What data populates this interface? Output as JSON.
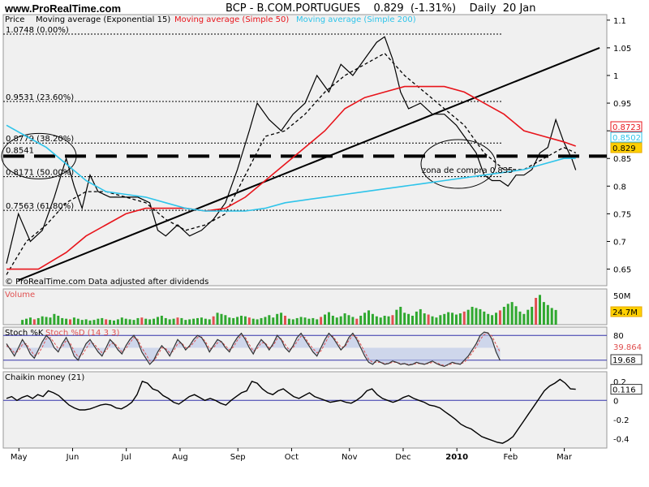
{
  "header": {
    "site": "www.ProRealTime.com",
    "title": "BCP - B.COM.PORTUGUES    0.829  (-1.31%)    Daily  20 Jan"
  },
  "colors": {
    "price": "#000000",
    "ema15": "#000000",
    "sma50": "#e8141b",
    "sma200": "#2ec4ea",
    "volume": "#2fa82f",
    "volume_down": "#e05050",
    "stoch_k": "#333333",
    "stoch_d": "#e05050",
    "stoch_fill": "#b8c4e8",
    "panel_bg": "#f0f0f0",
    "ref_line": "#3333aa"
  },
  "chart_data": [
    {
      "type": "line",
      "panel": "price",
      "legend": {
        "price": "Price",
        "ema15": "Moving average (Exponential 15)",
        "sma50": "Moving average (Simple 50)",
        "sma200": "Moving average (Simple 200)"
      },
      "x_labels": [
        "May",
        "Jun",
        "Jul",
        "Aug",
        "Sep",
        "Oct",
        "Nov",
        "Dec",
        "2010",
        "Feb",
        "Mar"
      ],
      "y_ticks": [
        0.65,
        0.7,
        0.75,
        0.8,
        0.85,
        0.9,
        0.95,
        1,
        1.05,
        1.1
      ],
      "ylim": [
        0.62,
        1.11
      ],
      "series": [
        {
          "name": "Price",
          "points": [
            [
              0,
              0.66
            ],
            [
              3,
              0.75
            ],
            [
              6,
              0.7
            ],
            [
              9,
              0.72
            ],
            [
              12,
              0.78
            ],
            [
              15,
              0.85
            ],
            [
              17,
              0.8
            ],
            [
              19,
              0.76
            ],
            [
              21,
              0.82
            ],
            [
              23,
              0.79
            ],
            [
              26,
              0.78
            ],
            [
              30,
              0.78
            ],
            [
              33,
              0.78
            ],
            [
              36,
              0.77
            ],
            [
              38,
              0.72
            ],
            [
              40,
              0.71
            ],
            [
              43,
              0.73
            ],
            [
              46,
              0.71
            ],
            [
              49,
              0.72
            ],
            [
              52,
              0.74
            ],
            [
              55,
              0.77
            ],
            [
              58,
              0.83
            ],
            [
              61,
              0.9
            ],
            [
              63,
              0.95
            ],
            [
              66,
              0.92
            ],
            [
              69,
              0.9
            ],
            [
              72,
              0.93
            ],
            [
              75,
              0.95
            ],
            [
              78,
              1.0
            ],
            [
              81,
              0.97
            ],
            [
              84,
              1.02
            ],
            [
              87,
              1.0
            ],
            [
              90,
              1.03
            ],
            [
              93,
              1.06
            ],
            [
              95,
              1.07
            ],
            [
              97,
              1.03
            ],
            [
              99,
              0.97
            ],
            [
              101,
              0.94
            ],
            [
              104,
              0.95
            ],
            [
              107,
              0.93
            ],
            [
              110,
              0.93
            ],
            [
              113,
              0.91
            ],
            [
              115,
              0.89
            ],
            [
              118,
              0.86
            ],
            [
              120,
              0.82
            ],
            [
              122,
              0.81
            ],
            [
              124,
              0.81
            ],
            [
              126,
              0.8
            ],
            [
              128,
              0.82
            ],
            [
              130,
              0.82
            ],
            [
              132,
              0.83
            ],
            [
              134,
              0.86
            ],
            [
              136,
              0.87
            ],
            [
              138,
              0.92
            ],
            [
              140,
              0.88
            ],
            [
              142,
              0.85
            ],
            [
              143,
              0.829
            ]
          ]
        },
        {
          "name": "Moving average (Exponential 15)",
          "points": [
            [
              0,
              0.64
            ],
            [
              5,
              0.7
            ],
            [
              10,
              0.73
            ],
            [
              15,
              0.77
            ],
            [
              20,
              0.79
            ],
            [
              25,
              0.79
            ],
            [
              30,
              0.78
            ],
            [
              35,
              0.77
            ],
            [
              40,
              0.74
            ],
            [
              45,
              0.72
            ],
            [
              50,
              0.73
            ],
            [
              55,
              0.75
            ],
            [
              60,
              0.82
            ],
            [
              65,
              0.89
            ],
            [
              70,
              0.9
            ],
            [
              75,
              0.93
            ],
            [
              80,
              0.97
            ],
            [
              85,
              1.0
            ],
            [
              90,
              1.02
            ],
            [
              95,
              1.04
            ],
            [
              100,
              1.0
            ],
            [
              105,
              0.97
            ],
            [
              110,
              0.94
            ],
            [
              115,
              0.91
            ],
            [
              120,
              0.86
            ],
            [
              125,
              0.83
            ],
            [
              130,
              0.83
            ],
            [
              135,
              0.85
            ],
            [
              140,
              0.87
            ],
            [
              143,
              0.86
            ]
          ]
        },
        {
          "name": "Moving average (Simple 50)",
          "points": [
            [
              0,
              0.65
            ],
            [
              8,
              0.65
            ],
            [
              15,
              0.68
            ],
            [
              20,
              0.71
            ],
            [
              25,
              0.73
            ],
            [
              30,
              0.75
            ],
            [
              35,
              0.76
            ],
            [
              40,
              0.76
            ],
            [
              45,
              0.76
            ],
            [
              50,
              0.755
            ],
            [
              55,
              0.76
            ],
            [
              60,
              0.78
            ],
            [
              65,
              0.81
            ],
            [
              70,
              0.84
            ],
            [
              75,
              0.87
            ],
            [
              80,
              0.9
            ],
            [
              85,
              0.94
            ],
            [
              90,
              0.96
            ],
            [
              95,
              0.97
            ],
            [
              100,
              0.98
            ],
            [
              105,
              0.98
            ],
            [
              110,
              0.98
            ],
            [
              115,
              0.97
            ],
            [
              120,
              0.95
            ],
            [
              125,
              0.93
            ],
            [
              130,
              0.9
            ],
            [
              135,
              0.89
            ],
            [
              140,
              0.88
            ],
            [
              143,
              0.8723
            ]
          ]
        },
        {
          "name": "Moving average (Simple 200)",
          "points": [
            [
              0,
              0.91
            ],
            [
              5,
              0.89
            ],
            [
              10,
              0.87
            ],
            [
              15,
              0.84
            ],
            [
              20,
              0.81
            ],
            [
              25,
              0.79
            ],
            [
              30,
              0.785
            ],
            [
              35,
              0.78
            ],
            [
              40,
              0.77
            ],
            [
              45,
              0.76
            ],
            [
              50,
              0.755
            ],
            [
              55,
              0.755
            ],
            [
              60,
              0.755
            ],
            [
              65,
              0.76
            ],
            [
              70,
              0.77
            ],
            [
              75,
              0.775
            ],
            [
              80,
              0.78
            ],
            [
              85,
              0.785
            ],
            [
              90,
              0.79
            ],
            [
              95,
              0.795
            ],
            [
              100,
              0.8
            ],
            [
              105,
              0.805
            ],
            [
              110,
              0.81
            ],
            [
              115,
              0.815
            ],
            [
              120,
              0.82
            ],
            [
              125,
              0.825
            ],
            [
              130,
              0.83
            ],
            [
              135,
              0.84
            ],
            [
              140,
              0.85
            ],
            [
              143,
              0.8502
            ]
          ]
        }
      ],
      "fib_levels": [
        {
          "label": "1.0748 (0.00%)",
          "value": 1.0748
        },
        {
          "label": "0.9531 (23.60%)",
          "value": 0.9531
        },
        {
          "label": "0.8779 (38.20%)",
          "value": 0.8779
        },
        {
          "label": "0.8171 (50.00%)",
          "value": 0.8171
        },
        {
          "label": "0.7563 (61.80%)",
          "value": 0.7563
        }
      ],
      "support_level": {
        "label": "0.8541",
        "value": 0.8541
      },
      "trendline": [
        [
          3,
          0.63
        ],
        [
          149,
          1.05
        ]
      ],
      "annotations": [
        "zona de compra 0.835",
        "© ProRealTime.com  Data adjusted after dividends"
      ],
      "last_values": [
        {
          "value": "0.8723",
          "series": "sma50"
        },
        {
          "value": "0.8502",
          "series": "sma200"
        },
        {
          "value": "0.829",
          "series": "price"
        }
      ]
    },
    {
      "type": "bar",
      "panel": "volume",
      "legend": "Volume",
      "y_tick": "50M",
      "last_value": "24.7M",
      "ylim": [
        0,
        60
      ],
      "values": [
        8,
        10,
        12,
        9,
        11,
        14,
        13,
        12,
        18,
        15,
        11,
        10,
        9,
        12,
        10,
        8,
        9,
        7,
        8,
        10,
        11,
        9,
        8,
        7,
        9,
        12,
        10,
        9,
        8,
        11,
        12,
        10,
        9,
        10,
        13,
        15,
        11,
        9,
        10,
        12,
        11,
        8,
        9,
        10,
        11,
        12,
        10,
        9,
        14,
        20,
        18,
        16,
        12,
        11,
        13,
        15,
        14,
        12,
        10,
        9,
        11,
        13,
        16,
        12,
        18,
        20,
        15,
        10,
        9,
        11,
        13,
        12,
        10,
        11,
        9,
        13,
        17,
        21,
        15,
        12,
        14,
        19,
        16,
        13,
        10,
        15,
        20,
        24,
        18,
        14,
        12,
        15,
        14,
        16,
        25,
        30,
        20,
        18,
        15,
        22,
        26,
        19,
        17,
        14,
        12,
        16,
        18,
        21,
        20,
        17,
        19,
        22,
        25,
        30,
        28,
        26,
        22,
        18,
        16,
        20,
        24,
        30,
        35,
        38,
        31,
        22,
        18,
        25,
        30,
        45,
        50,
        38,
        33,
        28,
        24.7
      ]
    },
    {
      "type": "line",
      "panel": "stochastic",
      "legend_k": "Stoch %K",
      "legend_d": "Stoch %D (14 3 3)",
      "ylim": [
        0,
        100
      ],
      "levels": [
        80,
        20
      ],
      "level_labels": [
        "80",
        "20"
      ],
      "last_values": {
        "d": "39.864",
        "k": "19.68"
      },
      "k": [
        60,
        45,
        30,
        50,
        70,
        55,
        35,
        25,
        45,
        65,
        80,
        70,
        50,
        40,
        60,
        75,
        55,
        30,
        20,
        40,
        60,
        70,
        55,
        40,
        30,
        50,
        70,
        60,
        45,
        35,
        55,
        70,
        80,
        65,
        40,
        25,
        10,
        20,
        40,
        55,
        45,
        30,
        50,
        70,
        60,
        45,
        55,
        70,
        80,
        75,
        60,
        40,
        55,
        70,
        65,
        50,
        40,
        60,
        75,
        85,
        70,
        50,
        35,
        55,
        70,
        60,
        45,
        60,
        80,
        70,
        50,
        40,
        55,
        75,
        85,
        70,
        55,
        40,
        30,
        50,
        70,
        85,
        75,
        60,
        45,
        55,
        75,
        85,
        70,
        50,
        30,
        15,
        10,
        20,
        15,
        10,
        12,
        18,
        15,
        10,
        12,
        8,
        10,
        15,
        12,
        10,
        14,
        18,
        12,
        8,
        5,
        10,
        15,
        12,
        10,
        20,
        30,
        45,
        60,
        80,
        88,
        86,
        70,
        40,
        19.68
      ],
      "d": [
        55,
        48,
        38,
        42,
        58,
        60,
        45,
        32,
        35,
        52,
        72,
        75,
        62,
        48,
        52,
        68,
        62,
        42,
        28,
        32,
        48,
        62,
        60,
        48,
        38,
        42,
        58,
        62,
        52,
        40,
        48,
        62,
        75,
        70,
        50,
        35,
        18,
        18,
        32,
        50,
        48,
        38,
        42,
        60,
        62,
        50,
        52,
        62,
        75,
        76,
        65,
        48,
        50,
        62,
        65,
        55,
        45,
        52,
        68,
        80,
        75,
        58,
        42,
        48,
        62,
        62,
        50,
        55,
        72,
        72,
        58,
        45,
        50,
        65,
        78,
        75,
        60,
        48,
        38,
        42,
        60,
        78,
        78,
        65,
        52,
        52,
        68,
        80,
        75,
        58,
        40,
        22,
        15,
        15,
        15,
        12,
        12,
        15,
        15,
        12,
        11,
        10,
        10,
        12,
        12,
        11,
        12,
        15,
        14,
        10,
        7,
        8,
        12,
        12,
        11,
        15,
        25,
        38,
        52,
        70,
        82,
        85,
        78,
        58,
        39.864
      ]
    },
    {
      "type": "line",
      "panel": "chaikin",
      "legend": "Chaikin money (21)",
      "y_ticks": [
        0.2,
        0,
        -0.2,
        -0.4
      ],
      "ylim": [
        -0.5,
        0.3
      ],
      "last_value": "0.116",
      "values": [
        0.02,
        0.04,
        0.0,
        0.03,
        0.05,
        0.02,
        0.06,
        0.04,
        0.1,
        0.08,
        0.05,
        0.0,
        -0.05,
        -0.08,
        -0.1,
        -0.1,
        -0.09,
        -0.07,
        -0.05,
        -0.04,
        -0.05,
        -0.08,
        -0.09,
        -0.06,
        -0.02,
        0.06,
        0.2,
        0.18,
        0.12,
        0.1,
        0.05,
        0.02,
        -0.02,
        -0.04,
        0.0,
        0.04,
        0.06,
        0.03,
        0.0,
        0.02,
        0.0,
        -0.03,
        -0.05,
        0.0,
        0.04,
        0.08,
        0.1,
        0.2,
        0.18,
        0.12,
        0.08,
        0.06,
        0.1,
        0.12,
        0.08,
        0.04,
        0.02,
        0.05,
        0.08,
        0.04,
        0.02,
        0.0,
        -0.02,
        -0.01,
        0.0,
        -0.02,
        -0.03,
        0.0,
        0.04,
        0.1,
        0.12,
        0.06,
        0.02,
        0.0,
        -0.02,
        0.0,
        0.03,
        0.05,
        0.02,
        0.0,
        -0.02,
        -0.05,
        -0.06,
        -0.08,
        -0.12,
        -0.16,
        -0.2,
        -0.25,
        -0.28,
        -0.3,
        -0.34,
        -0.38,
        -0.4,
        -0.42,
        -0.44,
        -0.45,
        -0.42,
        -0.38,
        -0.3,
        -0.22,
        -0.14,
        -0.06,
        0.02,
        0.1,
        0.15,
        0.18,
        0.22,
        0.18,
        0.12,
        0.116
      ]
    }
  ]
}
